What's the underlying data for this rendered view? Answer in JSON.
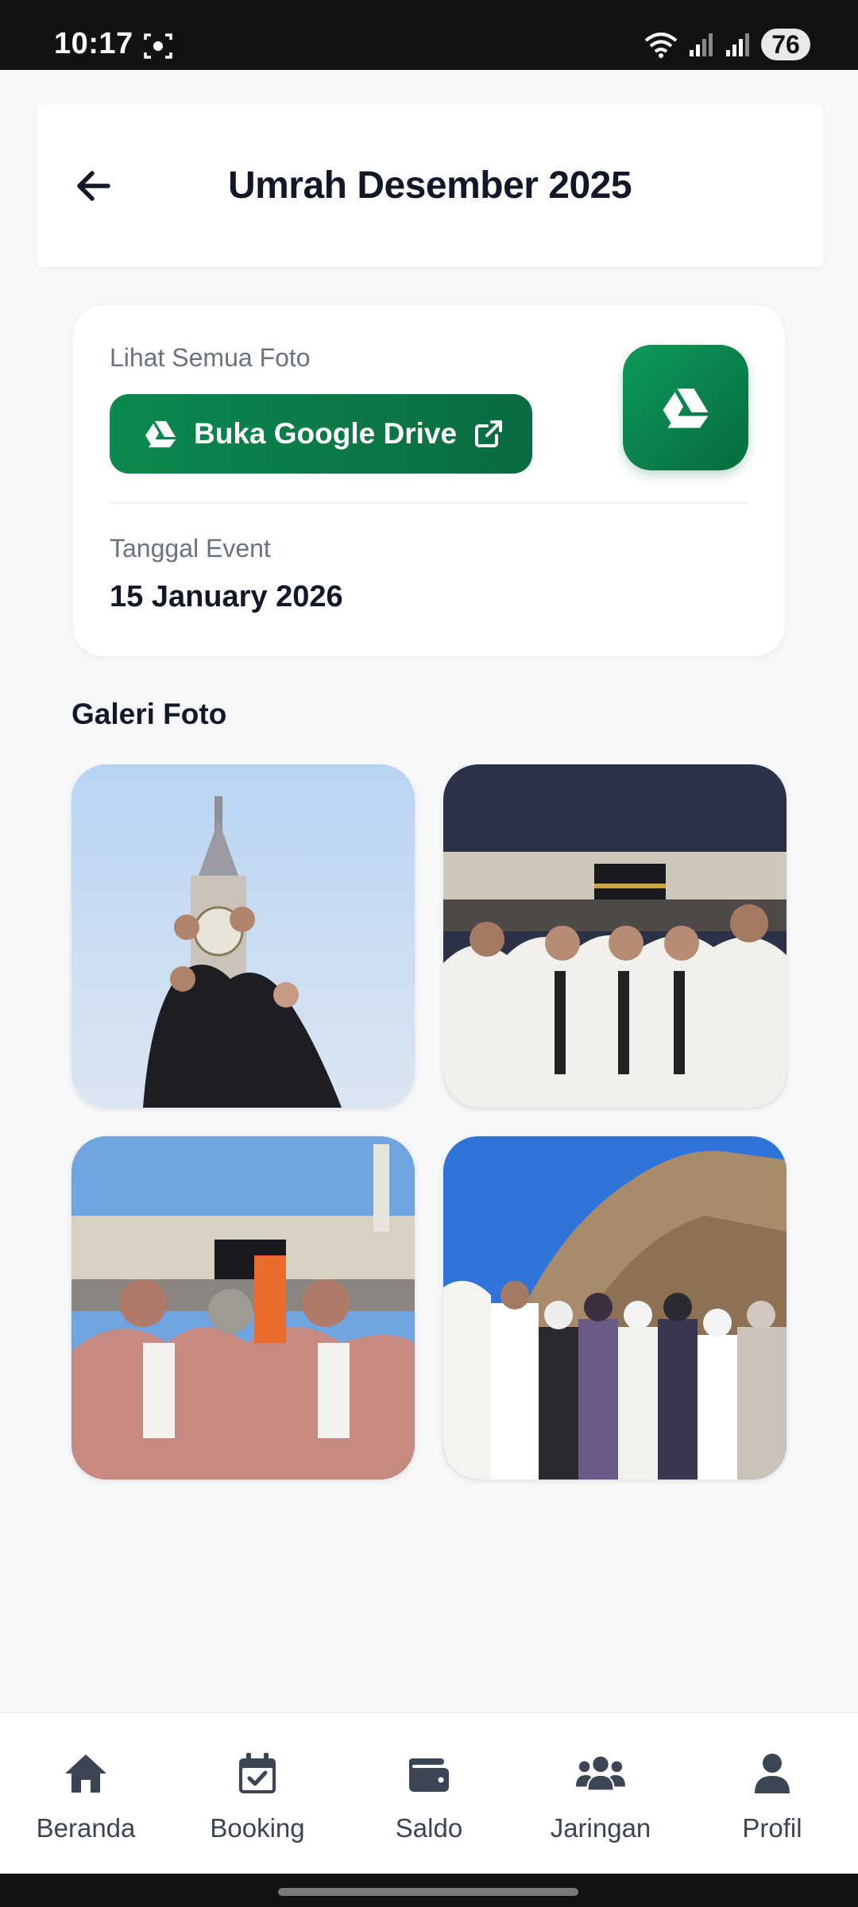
{
  "status_bar": {
    "time": "10:17",
    "battery": "76"
  },
  "header": {
    "title": "Umrah Desember 2025"
  },
  "drive_card": {
    "photos_label": "Lihat Semua Foto",
    "drive_button_label": "Buka Google Drive",
    "date_label": "Tanggal Event",
    "date_value": "15 January 2026"
  },
  "gallery": {
    "title": "Galeri Foto",
    "photos": [
      "photo-1",
      "photo-2",
      "photo-3",
      "photo-4"
    ]
  },
  "nav": {
    "items": [
      {
        "label": "Beranda",
        "icon": "home-icon"
      },
      {
        "label": "Booking",
        "icon": "calendar-check-icon"
      },
      {
        "label": "Saldo",
        "icon": "wallet-icon"
      },
      {
        "label": "Jaringan",
        "icon": "users-icon"
      },
      {
        "label": "Profil",
        "icon": "user-icon"
      }
    ]
  },
  "colors": {
    "brand_green": "#0a7a47",
    "nav_icon": "#3c4553",
    "background": "#f7f8fa"
  }
}
